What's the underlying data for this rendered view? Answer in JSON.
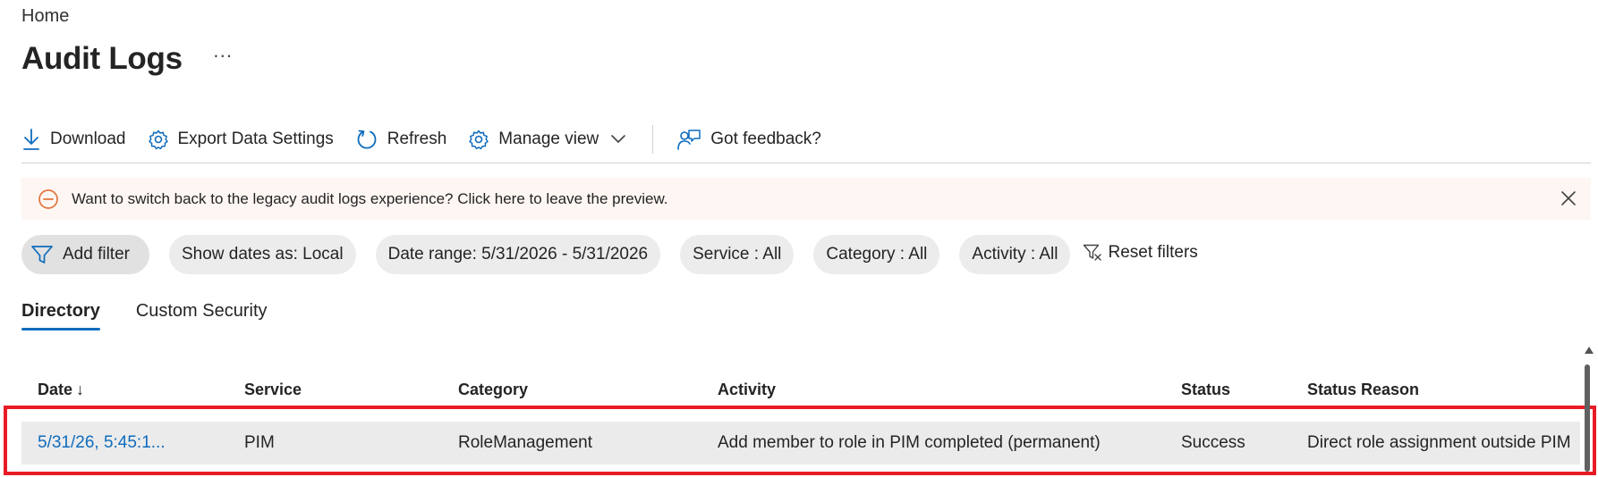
{
  "breadcrumb": {
    "home": "Home"
  },
  "page": {
    "title": "Audit Logs",
    "more": "···"
  },
  "toolbar": {
    "download": "Download",
    "export_settings": "Export Data Settings",
    "refresh": "Refresh",
    "manage_view": "Manage view",
    "feedback": "Got feedback?"
  },
  "banner": {
    "text": "Want to switch back to the legacy audit logs experience? Click here to leave the preview."
  },
  "filters": {
    "add_filter": "Add filter",
    "show_dates": "Show dates as: Local",
    "date_range": "Date range: 5/31/2026 - 5/31/2026",
    "service": "Service : All",
    "category": "Category : All",
    "activity": "Activity : All",
    "reset": "Reset filters"
  },
  "tabs": [
    {
      "label": "Directory",
      "active": true
    },
    {
      "label": "Custom Security",
      "active": false
    }
  ],
  "table": {
    "columns": [
      "Date",
      "Service",
      "Category",
      "Activity",
      "Status",
      "Status Reason"
    ],
    "sort_indicator": "↓",
    "rows": [
      {
        "date": "5/31/26, 5:45:1...",
        "service": "PIM",
        "category": "RoleManagement",
        "activity": "Add member to role in PIM completed (permanent)",
        "status": "Success",
        "status_reason": "Direct role assignment outside PIM"
      }
    ]
  },
  "colors": {
    "accent": "#0f6cbd",
    "banner_bg": "#fdf6f3",
    "warning": "#e2743c",
    "highlight_box": "#e81c24"
  }
}
